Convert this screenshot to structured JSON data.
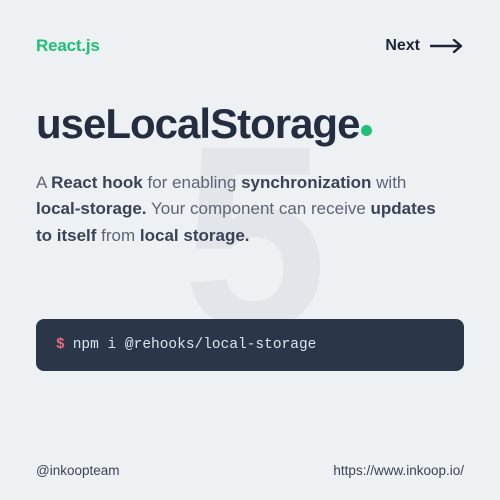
{
  "colors": {
    "accent": "#1fbf75",
    "prompt": "#e96a7c"
  },
  "header": {
    "brand": "React.js",
    "next_label": "Next"
  },
  "watermark": "5",
  "title": "useLocalStorage",
  "description": {
    "t1": "A ",
    "b1": "React hook",
    "t2": " for enabling ",
    "b2": "synchronization",
    "t3": " with ",
    "b3": "local-storage.",
    "t4": " Your component can receive ",
    "b4": "updates to itself",
    "t5": " from ",
    "b5": "local storage."
  },
  "code": {
    "prompt": "$",
    "command": "npm i @rehooks/local-storage"
  },
  "footer": {
    "handle": "@inkoopteam",
    "url": "https://www.inkoop.io/"
  }
}
